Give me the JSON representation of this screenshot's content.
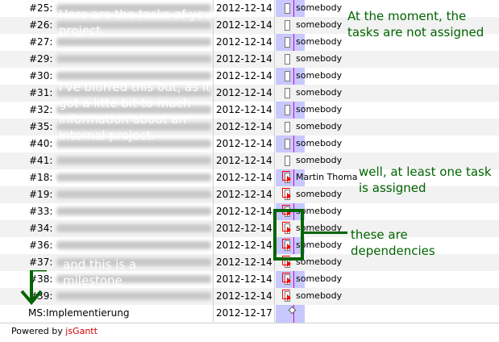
{
  "rows": [
    {
      "id": "#25:",
      "date": "2012-12-14",
      "resource": "somebody"
    },
    {
      "id": "#26:",
      "date": "2012-12-14",
      "resource": "somebody"
    },
    {
      "id": "#27:",
      "date": "2012-12-14",
      "resource": "somebody"
    },
    {
      "id": "#29:",
      "date": "2012-12-14",
      "resource": "somebody"
    },
    {
      "id": "#30:",
      "date": "2012-12-14",
      "resource": "somebody"
    },
    {
      "id": "#31:",
      "date": "2012-12-14",
      "resource": "somebody"
    },
    {
      "id": "#32:",
      "date": "2012-12-14",
      "resource": "somebody"
    },
    {
      "id": "#35:",
      "date": "2012-12-14",
      "resource": "somebody"
    },
    {
      "id": "#40:",
      "date": "2012-12-14",
      "resource": "somebody"
    },
    {
      "id": "#41:",
      "date": "2012-12-14",
      "resource": "somebody"
    },
    {
      "id": "#18:",
      "date": "2012-12-14",
      "resource": "Martin Thoma"
    },
    {
      "id": "#19:",
      "date": "2012-12-14",
      "resource": "somebody"
    },
    {
      "id": "#33:",
      "date": "2012-12-14",
      "resource": "somebody"
    },
    {
      "id": "#34:",
      "date": "2012-12-14",
      "resource": "somebody"
    },
    {
      "id": "#36:",
      "date": "2012-12-14",
      "resource": "somebody"
    },
    {
      "id": "#37:",
      "date": "2012-12-14",
      "resource": "somebody"
    },
    {
      "id": "#38:",
      "date": "2012-12-14",
      "resource": "somebody"
    },
    {
      "id": "#39:",
      "date": "2012-12-14",
      "resource": "somebody"
    }
  ],
  "milestone": {
    "id": "MS:Implementierung",
    "date": "2012-12-17"
  },
  "annotations": {
    "tasks_title": "Here are the tasks of your project.",
    "blurred_note": "I've blurred this out, as it got a litte bit to much information about an internal project.",
    "not_assigned": "At the moment, the tasks are not assigned",
    "one_assigned": "well, at least one task is assigned",
    "dependencies": "these are dependencies",
    "milestone": "and this is a milestone"
  },
  "footer": {
    "powered_label": "Powered by",
    "brand": "jsGantt"
  },
  "colors": {
    "annotation": "#006400",
    "chart_band": "#c8c8ff",
    "dependency": "#ff0000",
    "today_line": "#cc00cc",
    "brand": "#cc0000"
  }
}
